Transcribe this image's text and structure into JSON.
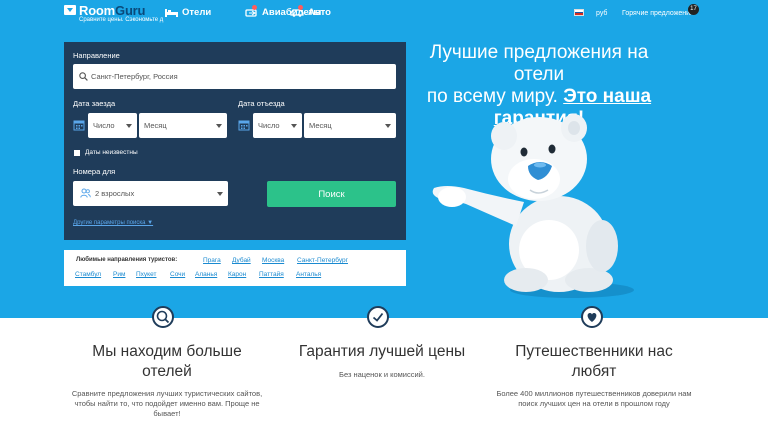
{
  "header": {
    "logo_room": "Room",
    "logo_guru": "Guru",
    "tagline": "Сравните цены. Сэкономьте д",
    "nav": [
      {
        "label": "Отели",
        "icon": "bed-icon"
      },
      {
        "label": "Авиабилеты",
        "icon": "plane-icon"
      },
      {
        "label": "Авто",
        "icon": "car-icon"
      }
    ],
    "currency": "руб",
    "deals_label": "Горячие предложения",
    "deals_count": "17"
  },
  "search": {
    "destination_label": "Направление",
    "destination_value": "Санкт-Петербург, Россия",
    "checkin_label": "Дата заезда",
    "checkout_label": "Дата отъезда",
    "day_placeholder": "Число",
    "month_placeholder": "Месяц",
    "dates_unknown_label": "Даты неизвестны",
    "rooms_label": "Номера для",
    "rooms_value": "2 взрослых",
    "search_button": "Поиск",
    "more_options": "Другие параметры поиска ▼"
  },
  "popular": {
    "label": "Любимые направления туристов:",
    "row1": [
      "Прага",
      "Дубай",
      "Москва",
      "Санкт-Петербург"
    ],
    "row2": [
      "Стамбул",
      "Рим",
      "Пхукет",
      "Сочи",
      "Аланья",
      "Карон",
      "Паттайя",
      "Анталья"
    ]
  },
  "headline": {
    "line1": "Лучшие предложения на отели",
    "line2_plain": "по всему миру.",
    "line2_strong": "Это наша",
    "line3_strong": "гарантия!"
  },
  "features": [
    {
      "icon": "search-icon",
      "title": "Мы находим больше отелей",
      "text": "Сравните предложения лучших туристических сайтов, чтобы найти то, что подойдет именно вам. Проще не бывает!"
    },
    {
      "icon": "checkmark-icon",
      "title": "Гарантия лучшей цены",
      "text": "Без наценок и комиссий."
    },
    {
      "icon": "heart-icon",
      "title": "Путешественники нас любят",
      "text": "Более 400 миллионов путешественников доверили нам поиск лучших цен на отели в прошлом году"
    }
  ]
}
